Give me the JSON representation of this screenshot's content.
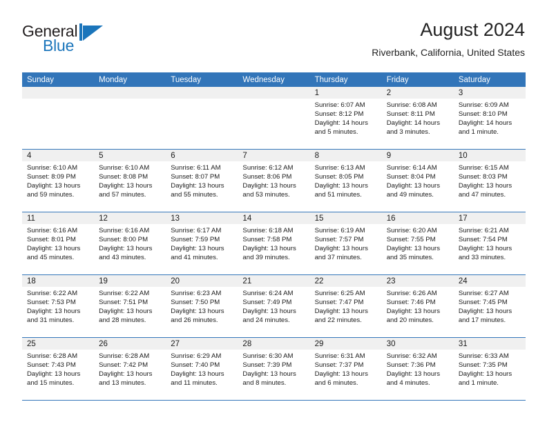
{
  "brand": {
    "word_one": "General",
    "word_two": "Blue",
    "mark_icon": "triangle-flag-icon",
    "accent_color": "#1b75bb"
  },
  "header": {
    "title": "August 2024",
    "subtitle": "Riverbank, California, United States"
  },
  "calendar": {
    "header_bg": "#3275b9",
    "day_band_bg": "#f0f0f0",
    "weekdays": [
      "Sunday",
      "Monday",
      "Tuesday",
      "Wednesday",
      "Thursday",
      "Friday",
      "Saturday"
    ],
    "weeks": [
      [
        {
          "day": "",
          "sunrise": "",
          "sunset": "",
          "daylight": "",
          "empty": true
        },
        {
          "day": "",
          "sunrise": "",
          "sunset": "",
          "daylight": "",
          "empty": true
        },
        {
          "day": "",
          "sunrise": "",
          "sunset": "",
          "daylight": "",
          "empty": true
        },
        {
          "day": "",
          "sunrise": "",
          "sunset": "",
          "daylight": "",
          "empty": true
        },
        {
          "day": "1",
          "sunrise": "Sunrise: 6:07 AM",
          "sunset": "Sunset: 8:12 PM",
          "daylight": "Daylight: 14 hours and 5 minutes."
        },
        {
          "day": "2",
          "sunrise": "Sunrise: 6:08 AM",
          "sunset": "Sunset: 8:11 PM",
          "daylight": "Daylight: 14 hours and 3 minutes."
        },
        {
          "day": "3",
          "sunrise": "Sunrise: 6:09 AM",
          "sunset": "Sunset: 8:10 PM",
          "daylight": "Daylight: 14 hours and 1 minute."
        }
      ],
      [
        {
          "day": "4",
          "sunrise": "Sunrise: 6:10 AM",
          "sunset": "Sunset: 8:09 PM",
          "daylight": "Daylight: 13 hours and 59 minutes."
        },
        {
          "day": "5",
          "sunrise": "Sunrise: 6:10 AM",
          "sunset": "Sunset: 8:08 PM",
          "daylight": "Daylight: 13 hours and 57 minutes."
        },
        {
          "day": "6",
          "sunrise": "Sunrise: 6:11 AM",
          "sunset": "Sunset: 8:07 PM",
          "daylight": "Daylight: 13 hours and 55 minutes."
        },
        {
          "day": "7",
          "sunrise": "Sunrise: 6:12 AM",
          "sunset": "Sunset: 8:06 PM",
          "daylight": "Daylight: 13 hours and 53 minutes."
        },
        {
          "day": "8",
          "sunrise": "Sunrise: 6:13 AM",
          "sunset": "Sunset: 8:05 PM",
          "daylight": "Daylight: 13 hours and 51 minutes."
        },
        {
          "day": "9",
          "sunrise": "Sunrise: 6:14 AM",
          "sunset": "Sunset: 8:04 PM",
          "daylight": "Daylight: 13 hours and 49 minutes."
        },
        {
          "day": "10",
          "sunrise": "Sunrise: 6:15 AM",
          "sunset": "Sunset: 8:03 PM",
          "daylight": "Daylight: 13 hours and 47 minutes."
        }
      ],
      [
        {
          "day": "11",
          "sunrise": "Sunrise: 6:16 AM",
          "sunset": "Sunset: 8:01 PM",
          "daylight": "Daylight: 13 hours and 45 minutes."
        },
        {
          "day": "12",
          "sunrise": "Sunrise: 6:16 AM",
          "sunset": "Sunset: 8:00 PM",
          "daylight": "Daylight: 13 hours and 43 minutes."
        },
        {
          "day": "13",
          "sunrise": "Sunrise: 6:17 AM",
          "sunset": "Sunset: 7:59 PM",
          "daylight": "Daylight: 13 hours and 41 minutes."
        },
        {
          "day": "14",
          "sunrise": "Sunrise: 6:18 AM",
          "sunset": "Sunset: 7:58 PM",
          "daylight": "Daylight: 13 hours and 39 minutes."
        },
        {
          "day": "15",
          "sunrise": "Sunrise: 6:19 AM",
          "sunset": "Sunset: 7:57 PM",
          "daylight": "Daylight: 13 hours and 37 minutes."
        },
        {
          "day": "16",
          "sunrise": "Sunrise: 6:20 AM",
          "sunset": "Sunset: 7:55 PM",
          "daylight": "Daylight: 13 hours and 35 minutes."
        },
        {
          "day": "17",
          "sunrise": "Sunrise: 6:21 AM",
          "sunset": "Sunset: 7:54 PM",
          "daylight": "Daylight: 13 hours and 33 minutes."
        }
      ],
      [
        {
          "day": "18",
          "sunrise": "Sunrise: 6:22 AM",
          "sunset": "Sunset: 7:53 PM",
          "daylight": "Daylight: 13 hours and 31 minutes."
        },
        {
          "day": "19",
          "sunrise": "Sunrise: 6:22 AM",
          "sunset": "Sunset: 7:51 PM",
          "daylight": "Daylight: 13 hours and 28 minutes."
        },
        {
          "day": "20",
          "sunrise": "Sunrise: 6:23 AM",
          "sunset": "Sunset: 7:50 PM",
          "daylight": "Daylight: 13 hours and 26 minutes."
        },
        {
          "day": "21",
          "sunrise": "Sunrise: 6:24 AM",
          "sunset": "Sunset: 7:49 PM",
          "daylight": "Daylight: 13 hours and 24 minutes."
        },
        {
          "day": "22",
          "sunrise": "Sunrise: 6:25 AM",
          "sunset": "Sunset: 7:47 PM",
          "daylight": "Daylight: 13 hours and 22 minutes."
        },
        {
          "day": "23",
          "sunrise": "Sunrise: 6:26 AM",
          "sunset": "Sunset: 7:46 PM",
          "daylight": "Daylight: 13 hours and 20 minutes."
        },
        {
          "day": "24",
          "sunrise": "Sunrise: 6:27 AM",
          "sunset": "Sunset: 7:45 PM",
          "daylight": "Daylight: 13 hours and 17 minutes."
        }
      ],
      [
        {
          "day": "25",
          "sunrise": "Sunrise: 6:28 AM",
          "sunset": "Sunset: 7:43 PM",
          "daylight": "Daylight: 13 hours and 15 minutes."
        },
        {
          "day": "26",
          "sunrise": "Sunrise: 6:28 AM",
          "sunset": "Sunset: 7:42 PM",
          "daylight": "Daylight: 13 hours and 13 minutes."
        },
        {
          "day": "27",
          "sunrise": "Sunrise: 6:29 AM",
          "sunset": "Sunset: 7:40 PM",
          "daylight": "Daylight: 13 hours and 11 minutes."
        },
        {
          "day": "28",
          "sunrise": "Sunrise: 6:30 AM",
          "sunset": "Sunset: 7:39 PM",
          "daylight": "Daylight: 13 hours and 8 minutes."
        },
        {
          "day": "29",
          "sunrise": "Sunrise: 6:31 AM",
          "sunset": "Sunset: 7:37 PM",
          "daylight": "Daylight: 13 hours and 6 minutes."
        },
        {
          "day": "30",
          "sunrise": "Sunrise: 6:32 AM",
          "sunset": "Sunset: 7:36 PM",
          "daylight": "Daylight: 13 hours and 4 minutes."
        },
        {
          "day": "31",
          "sunrise": "Sunrise: 6:33 AM",
          "sunset": "Sunset: 7:35 PM",
          "daylight": "Daylight: 13 hours and 1 minute."
        }
      ]
    ]
  }
}
